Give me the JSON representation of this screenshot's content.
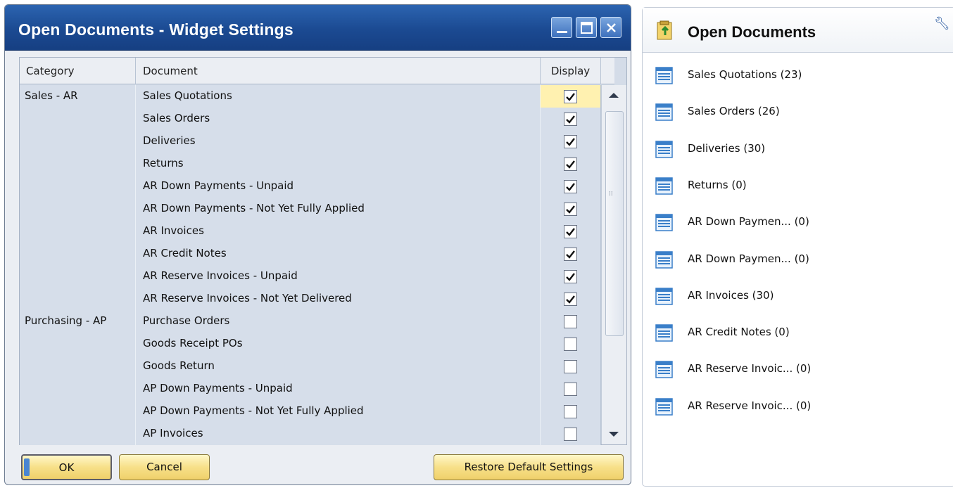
{
  "dialog": {
    "title": "Open Documents - Widget Settings",
    "columns": {
      "category": "Category",
      "document": "Document",
      "display": "Display"
    },
    "rows": [
      {
        "category": "Sales - AR",
        "document": "Sales Quotations",
        "checked": true
      },
      {
        "category": "",
        "document": "Sales Orders",
        "checked": true
      },
      {
        "category": "",
        "document": "Deliveries",
        "checked": true
      },
      {
        "category": "",
        "document": "Returns",
        "checked": true
      },
      {
        "category": "",
        "document": "AR Down Payments - Unpaid",
        "checked": true
      },
      {
        "category": "",
        "document": "AR Down Payments - Not Yet Fully Applied",
        "checked": true
      },
      {
        "category": "",
        "document": "AR Invoices",
        "checked": true
      },
      {
        "category": "",
        "document": "AR Credit Notes",
        "checked": true
      },
      {
        "category": "",
        "document": "AR Reserve Invoices - Unpaid",
        "checked": true
      },
      {
        "category": "",
        "document": "AR Reserve Invoices - Not Yet Delivered",
        "checked": true
      },
      {
        "category": "Purchasing - AP",
        "document": "Purchase Orders",
        "checked": false
      },
      {
        "category": "",
        "document": "Goods Receipt POs",
        "checked": false
      },
      {
        "category": "",
        "document": "Goods Return",
        "checked": false
      },
      {
        "category": "",
        "document": "AP Down Payments - Unpaid",
        "checked": false
      },
      {
        "category": "",
        "document": "AP Down Payments - Not Yet Fully Applied",
        "checked": false
      },
      {
        "category": "",
        "document": "AP Invoices",
        "checked": false
      }
    ],
    "buttons": {
      "ok": "OK",
      "cancel": "Cancel",
      "restore": "Restore Default Settings"
    }
  },
  "widget": {
    "title": "Open Documents",
    "items": [
      "Sales Quotations (23)",
      "Sales Orders (26)",
      "Deliveries (30)",
      "Returns (0)",
      "AR Down Paymen... (0)",
      "AR Down Paymen... (0)",
      "AR Invoices (30)",
      "AR Credit Notes (0)",
      "AR Reserve Invoic... (0)",
      "AR Reserve Invoic... (0)"
    ]
  },
  "colors": {
    "titlebar": "#1b4a92",
    "rowBg": "#d6deea",
    "activeCell": "#fff1b0",
    "button": "#f7e089"
  }
}
